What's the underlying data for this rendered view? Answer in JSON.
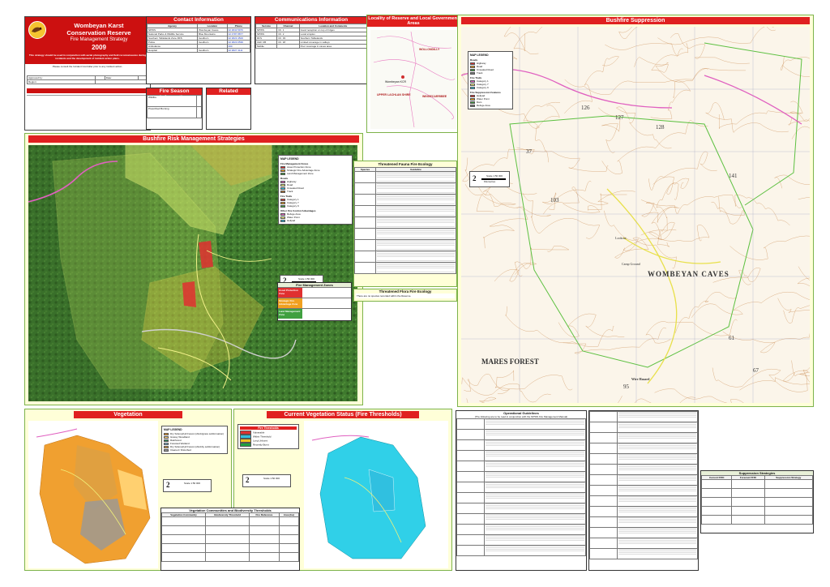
{
  "header": {
    "line1": "Wombeyan Karst",
    "line2": "Conservation Reserve",
    "line3": "Fire Management Strategy",
    "year": "2009",
    "description": "This strategy should be used in conjunction with aerial photography and field reconnaissance during incidents and the development of incident action plans.",
    "notice": "Please consult the Incident Controller prior to any incident action.",
    "logo_text": "NSW NATIONAL PARKS AND WILDLIFE SERVICE",
    "approved_label": "Approved by:",
    "date_label": "Date:",
    "region_label": "Region:"
  },
  "contacts": {
    "title": "Contact Information",
    "col_agency": "Agency",
    "col_location": "Location",
    "col_phone": "Phone",
    "rows": [
      {
        "agency": "NPWS",
        "location": "Wombeyan Caves",
        "phone": "02 4843 5976"
      },
      {
        "agency": "National Parks & Wildlife Service",
        "location": "Blue Mountains",
        "phone": "02 4787 8877"
      },
      {
        "agency": "Southern Tablelands Zone RFS",
        "location": "Goulburn",
        "phone": "02 4823 4500"
      },
      {
        "agency": "Police",
        "location": "Goulburn",
        "phone": "02 4823 0599"
      },
      {
        "agency": "Ambulance",
        "location": "",
        "phone": "000"
      },
      {
        "agency": "Hospital",
        "location": "Goulburn",
        "phone": "02 4827 3111"
      }
    ]
  },
  "communications": {
    "title": "Communications Information",
    "col_service": "Service",
    "col_channel": "Channel",
    "col_location": "Location and Comments",
    "rows": [
      {
        "service": "NPWS",
        "channel": "Ch. 1",
        "comment": "Good reception on top of ridges"
      },
      {
        "service": "NPWS",
        "channel": "Ch. 2",
        "comment": "Local simplex"
      },
      {
        "service": "RFS",
        "channel": "Ch. 33",
        "comment": "Southern Tablelands"
      },
      {
        "service": "UHF CB",
        "channel": "Ch. 18",
        "comment": "Limited coverage in valleys"
      },
      {
        "service": "Mobile",
        "channel": "",
        "comment": "Poor coverage in caves area"
      }
    ]
  },
  "locality": {
    "title": "Locality of Reserve and Local Government Areas",
    "labels": [
      "WOLLONDILLY",
      "UPPER LACHLAN SHIRE",
      "WINGECARRIBEE",
      "Wombeyan KCR"
    ]
  },
  "fire_suppression": {
    "title": "Bushfire Suppression",
    "place_labels": [
      "WOMBEYAN CAVES",
      "MARES FOREST",
      "Wire Hazard",
      "Camp Ground",
      "Lookout"
    ],
    "grid_numbers": [
      "126",
      "127",
      "128",
      "103",
      "37",
      "61",
      "67",
      "95",
      "141"
    ]
  },
  "risk_management": {
    "title": "Bushfire Risk Management Strategies"
  },
  "legend_fs": {
    "title": "MAP LEGEND",
    "sections": [
      {
        "name": "Roads",
        "items": [
          "Highway",
          "Road",
          "Unsealed Road",
          "Track"
        ]
      },
      {
        "name": "Fire Trails",
        "items": [
          "Category 1",
          "Category 7",
          "Category 9"
        ]
      },
      {
        "name": "Fire Suppression Features",
        "items": [
          "Helipad",
          "Water Point",
          "Dam",
          "Refuge Area"
        ]
      }
    ]
  },
  "legend_rm": {
    "title": "MAP LEGEND",
    "sections": [
      {
        "name": "Fire Management Zones",
        "items": [
          "Asset Protection Zone",
          "Strategic Fire Advantage Zone",
          "Land Management Zone"
        ]
      },
      {
        "name": "Roads",
        "items": [
          "Highway",
          "Road",
          "Unsealed Road",
          "Track"
        ]
      },
      {
        "name": "Fire Trails",
        "items": [
          "Category 1",
          "Category 7",
          "Category 9"
        ]
      },
      {
        "name": "Other Fire Control Advantages",
        "items": [
          "Refuge Area",
          "Water Point",
          "Helipad"
        ]
      }
    ]
  },
  "threatened_fauna": {
    "title": "Threatened Fauna Fire Ecology",
    "col_species": "Species",
    "col_guideline": "Guideline"
  },
  "threatened_flora": {
    "title": "Threatened Flora Fire Ecology",
    "text": "There are no species recorded within the Reserve."
  },
  "fmz": {
    "title": "Fire Management Zones",
    "rows": [
      {
        "zone": "Asset Protection Zone",
        "color": "#e03030"
      },
      {
        "zone": "Strategic Fire Advantage Zone",
        "color": "#f0a020"
      },
      {
        "zone": "Land Management Zone",
        "color": "#40a040"
      }
    ]
  },
  "vegetation": {
    "title": "Vegetation",
    "legend_title": "MAP LEGEND",
    "items": [
      "Dry Sclerophyll Forest (shrub/grass subformation)",
      "Grassy Woodland",
      "Rainforest",
      "Forested Wetland",
      "Dry Sclerophyll Forest (shrubby subformation)",
      "Cleared / Disturbed"
    ]
  },
  "current_status": {
    "title": "Current Vegetation Status (Fire Thresholds)",
    "legend_title": "Fire Thresholds",
    "items": [
      {
        "label": "Vulnerable",
        "color": "#e03030"
      },
      {
        "label": "Within Threshold",
        "color": "#30c0e0"
      },
      {
        "label": "Long Unburnt",
        "color": "#f0c020"
      },
      {
        "label": "Recently Burnt",
        "color": "#20a040"
      }
    ]
  },
  "veg_thresholds": {
    "title": "Vegetation Communities and Biodiversity Thresholds",
    "col_community": "Vegetation Community",
    "col_threshold": "Biodiversity Threshold",
    "col_ref": "Fire Reference",
    "col_area": "Area (ha)"
  },
  "operational": {
    "title": "Operational Guidelines",
    "subtitle": "(The following are to be read in conjunction with the NPWS Fire Management Manual)"
  },
  "suppression_strategies": {
    "title": "Suppression Strategies",
    "headers": [
      "Current FFDI",
      "Forecast FFDI",
      "Suppression Strategy"
    ]
  },
  "scale": {
    "label": "Scale 1:50 000",
    "units": "Kilometres",
    "north": "2"
  },
  "fire_season": {
    "title": "Fire Season Information",
    "wildfire_label": "Wildfire",
    "burn_label": "Prescribed Burning"
  },
  "related_docs": {
    "title": "Related Documents"
  },
  "colors": {
    "accent": "#e02020",
    "panel_border": "#7db34a",
    "panel_bg": "#ffffd8",
    "apz": "#e03030",
    "sfaz": "#f0a020",
    "lmz": "#40a040",
    "within_threshold": "#30c0e0",
    "veg_orange": "#f0a030"
  }
}
